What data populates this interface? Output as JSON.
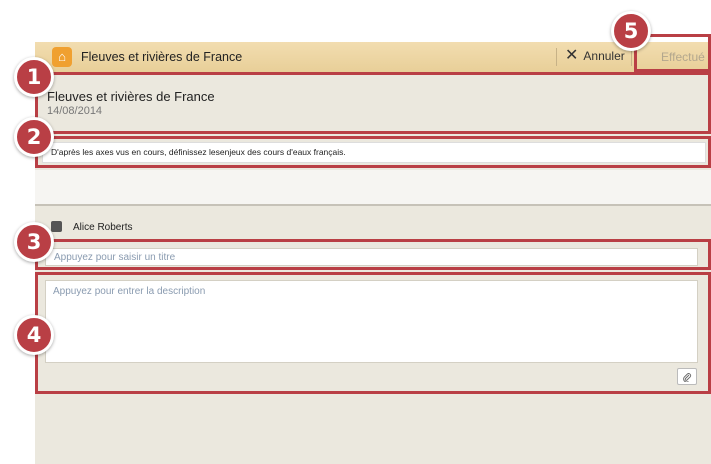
{
  "header": {
    "title": "Fleuves et rivières de France",
    "cancel_label": "Annuler",
    "done_label": "Effectué"
  },
  "info": {
    "title": "Fleuves et rivières de France",
    "date": "14/08/2014"
  },
  "instruction": "D'après les axes vus en cours, définissez lesenjeux des cours d'eaux français.",
  "author": {
    "name": "Alice Roberts"
  },
  "form": {
    "title_placeholder": "Appuyez pour saisir un titre",
    "description_placeholder": "Appuyez pour entrer la description"
  },
  "badges": [
    "1",
    "2",
    "3",
    "4",
    "5"
  ],
  "colors": {
    "highlight": "#b93f45",
    "header": "#efd9a9",
    "background": "#ebe8de"
  }
}
